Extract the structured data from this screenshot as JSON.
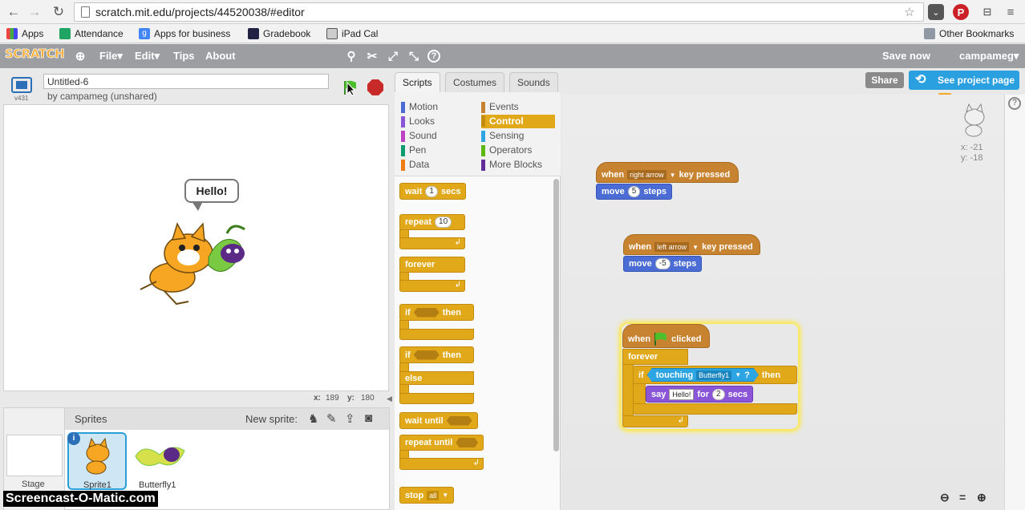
{
  "browser": {
    "url": "scratch.mit.edu/projects/44520038/#editor",
    "bookmarks": [
      {
        "label": "Apps",
        "icon": "apps-grid-icon"
      },
      {
        "label": "Attendance",
        "icon": "sheets-icon"
      },
      {
        "label": "Apps for business",
        "icon": "google-icon"
      },
      {
        "label": "Gradebook",
        "icon": "gradebook-icon"
      },
      {
        "label": "iPad Cal",
        "icon": "calendar-icon"
      }
    ],
    "other_bookmarks": "Other Bookmarks"
  },
  "menubar": {
    "logo": "SCRATCH",
    "file": "File▾",
    "edit": "Edit▾",
    "tips": "Tips",
    "about": "About",
    "save_now": "Save now",
    "username": "campameg▾"
  },
  "project": {
    "title": "Untitled-6",
    "byline": "by campameg (unshared)",
    "version": "v431",
    "share": "Share",
    "see_project_page": "See project page"
  },
  "stage": {
    "speech": "Hello!",
    "x_label": "x:",
    "x_value": "189",
    "y_label": "y:",
    "y_value": "180"
  },
  "sprites": {
    "header": "Sprites",
    "new_sprite": "New sprite:",
    "stage_label": "Stage",
    "items": [
      "Sprite1",
      "Butterfly1"
    ]
  },
  "tabs": [
    "Scripts",
    "Costumes",
    "Sounds"
  ],
  "categories": {
    "left": [
      {
        "label": "Motion",
        "color": "#4a6cd4"
      },
      {
        "label": "Looks",
        "color": "#8a55d7"
      },
      {
        "label": "Sound",
        "color": "#bb42c3"
      },
      {
        "label": "Pen",
        "color": "#0e9a6c"
      },
      {
        "label": "Data",
        "color": "#ee7d16"
      }
    ],
    "right": [
      {
        "label": "Events",
        "color": "#c88330"
      },
      {
        "label": "Control",
        "color": "#e1a91a"
      },
      {
        "label": "Sensing",
        "color": "#2ca5e2"
      },
      {
        "label": "Operators",
        "color": "#5cb712"
      },
      {
        "label": "More Blocks",
        "color": "#632d99"
      }
    ]
  },
  "palette": {
    "wait": "wait",
    "wait_num": "1",
    "secs": "secs",
    "repeat": "repeat",
    "repeat_num": "10",
    "forever": "forever",
    "if": "if",
    "then": "then",
    "else": "else",
    "wait_until": "wait until",
    "repeat_until": "repeat until",
    "stop": "stop",
    "stop_opt": "all"
  },
  "scripts": {
    "s1_when": "when",
    "s1_key": "right arrow",
    "s1_pressed": "key pressed",
    "s1_move": "move",
    "s1_steps_num": "5",
    "s1_steps": "steps",
    "s2_when": "when",
    "s2_key": "left arrow",
    "s2_pressed": "key pressed",
    "s2_move": "move",
    "s2_steps_num": "-5",
    "s2_steps": "steps",
    "s3_when": "when",
    "s3_clicked": "clicked",
    "s3_forever": "forever",
    "s3_if": "if",
    "s3_touching": "touching",
    "s3_target": "Butterfly1",
    "s3_q": "?",
    "s3_then": "then",
    "s3_say": "say",
    "s3_say_text": "Hello!",
    "s3_for": "for",
    "s3_for_num": "2",
    "s3_secs": "secs"
  },
  "sprite_info": {
    "x": "x: -21",
    "y": "y: -18"
  },
  "watermark": "Screencast-O-Matic.com"
}
